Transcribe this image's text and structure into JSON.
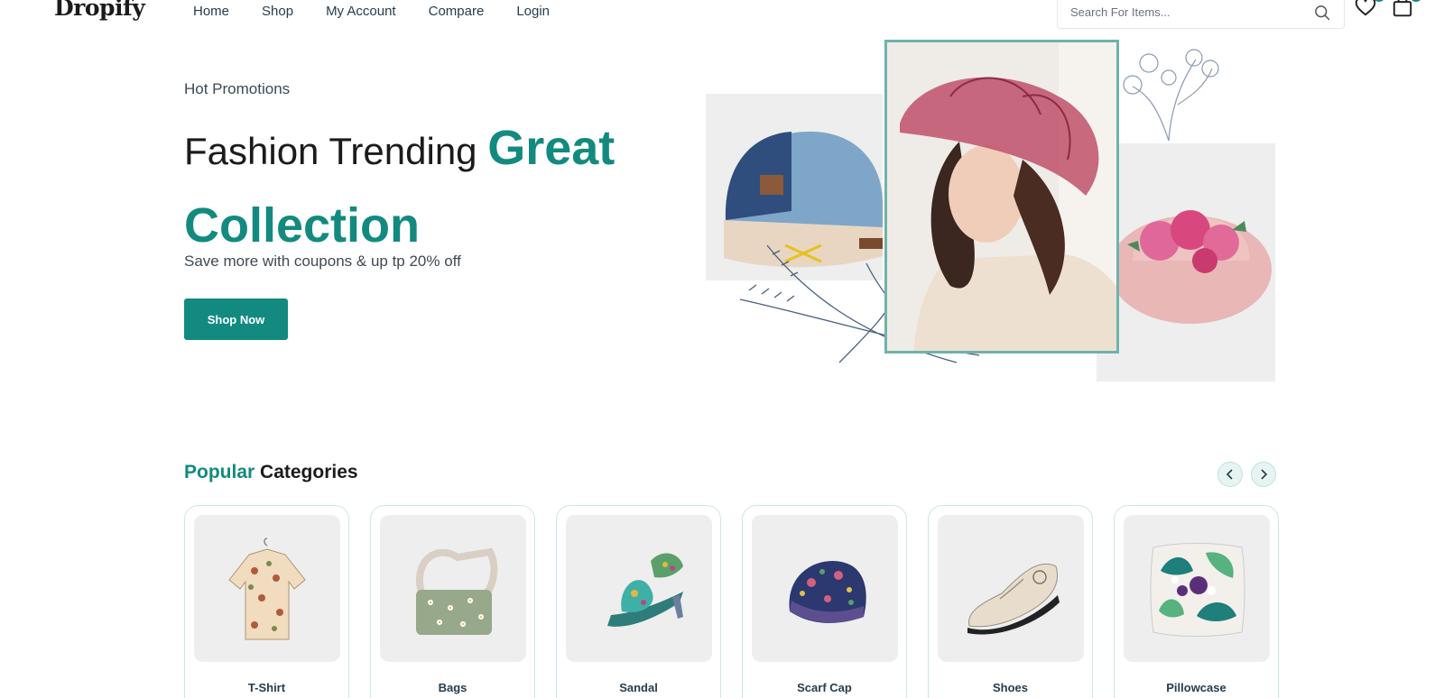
{
  "header": {
    "logo": "Dropify",
    "nav": [
      "Home",
      "Shop",
      "My Account",
      "Compare",
      "Login"
    ],
    "search_placeholder": "Search For Items..."
  },
  "hero": {
    "eyebrow": "Hot Promotions",
    "title_dark": "Fashion Trending ",
    "title_accent": "Great Collection",
    "subtitle": "Save more with coupons & up tp 20% off",
    "cta": "Shop Now"
  },
  "categories": {
    "title_accent": "Popular",
    "title_rest": " Categories",
    "items": [
      {
        "label": "T-Shirt",
        "icon": "shirt-icon"
      },
      {
        "label": "Bags",
        "icon": "bag-icon"
      },
      {
        "label": "Sandal",
        "icon": "sandal-icon"
      },
      {
        "label": "Scarf Cap",
        "icon": "cap-icon"
      },
      {
        "label": "Shoes",
        "icon": "shoe-icon"
      },
      {
        "label": "Pillowcase",
        "icon": "pillow-icon"
      }
    ]
  },
  "colors": {
    "accent": "#138a7f",
    "text_dark": "#1b1b1b",
    "panel_bg": "#eeeeee"
  }
}
